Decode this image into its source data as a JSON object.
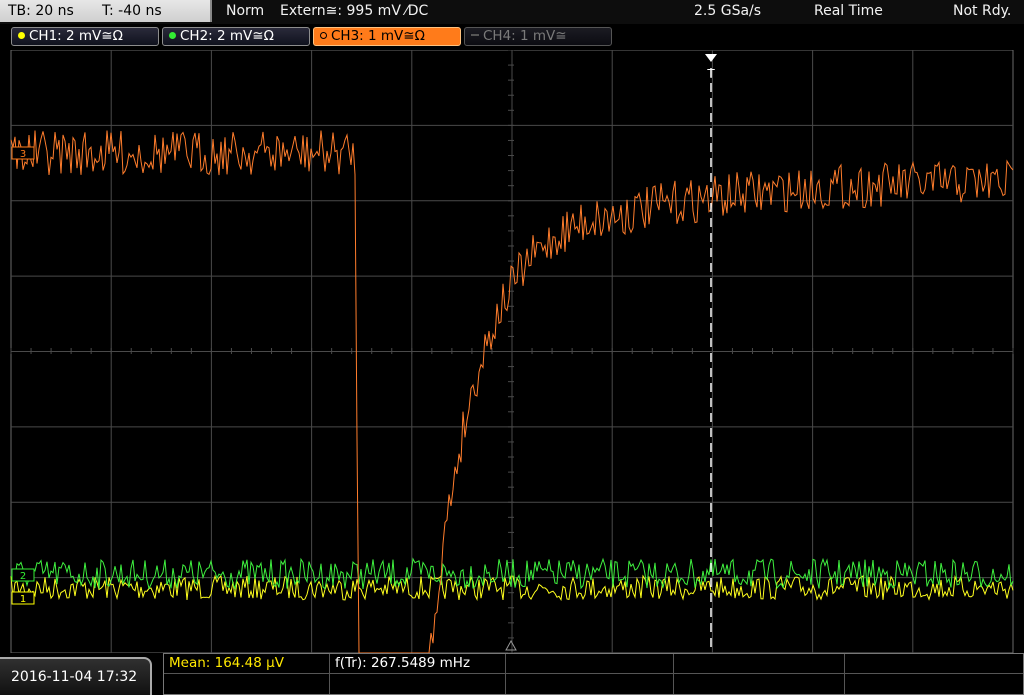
{
  "status_bar": {
    "timebase": "TB: 20 ns",
    "trigger_offset": "T: -40 ns",
    "trigger_mode": "Norm",
    "trigger_source": "Extern≅: 995 mV ⁄DC",
    "sample_rate": "2.5 GSa/s",
    "acquisition_mode": "Real Time",
    "status": "Not Rdy."
  },
  "channels": [
    {
      "label": "CH1: 2 mV≅Ω",
      "color": "#ffff00",
      "state": "on"
    },
    {
      "label": "CH2: 2 mV≅Ω",
      "color": "#33ee33",
      "state": "on"
    },
    {
      "label": "CH3: 1 mV≅Ω",
      "color": "#ff7b1a",
      "state": "active"
    },
    {
      "label": "CH4: 1 mV≅",
      "color": "#777777",
      "state": "off"
    }
  ],
  "waveform_markers": {
    "ch3": "3",
    "ch2": "2",
    "ch1": "1",
    "trigger": "T"
  },
  "trace_colors": {
    "ch1": "#ffff1e",
    "ch2": "#3ff03f",
    "ch3": "#ff7d2c",
    "grid": "#4a4a4a"
  },
  "footer": {
    "datetime": "2016-11-04 17:32",
    "measurements": [
      {
        "label": "Mean: 164.48 µV",
        "color": "#ffe800"
      },
      {
        "label": "f(Tr): 267.5489 mHz",
        "color": "#ffffff"
      }
    ]
  }
}
